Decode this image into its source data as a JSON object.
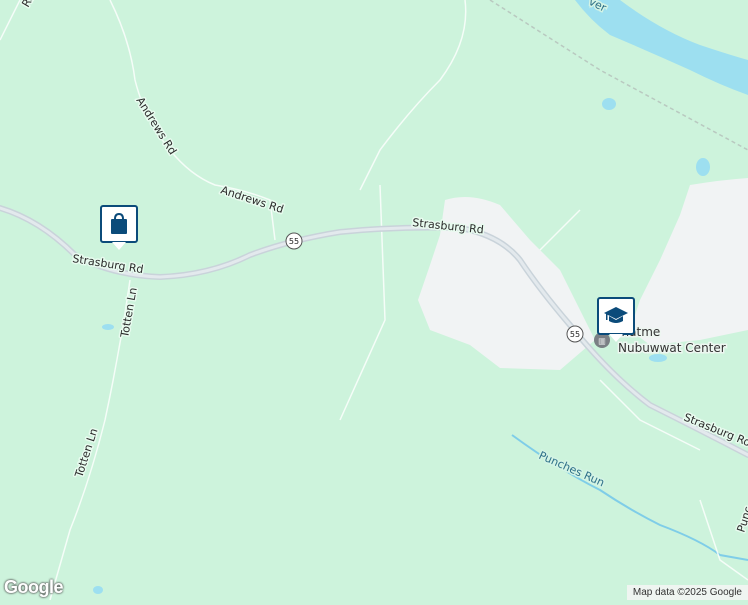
{
  "map": {
    "roads": {
      "strasburg_rd_west": "Strasburg Rd",
      "strasburg_rd_center": "Strasburg Rd",
      "strasburg_rd_east": "Strasburg Ro",
      "andrews_rd_north": "Andrews Rd",
      "andrews_rd_south": "Andrews Rd",
      "totten_ln_north": "Totten Ln",
      "totten_ln_south": "Totten Ln",
      "route_shield_west": "55",
      "route_shield_east": "55",
      "top_left_fragment": "Ro",
      "east_edge_fragment": "Punc"
    },
    "water": {
      "stream": "Punches Run",
      "river_fragment": "ver"
    },
    "places": {
      "center_name_line1": "Ihatme",
      "center_name_line2": "Nubuwwat Center"
    },
    "markers": {
      "shopping": "shopping-bag-icon",
      "school": "graduation-cap-icon"
    },
    "colors": {
      "land": "#cdf3dc",
      "urban": "#f1f3f4",
      "water": "#9ddff0",
      "highway": "#c9d3da",
      "marker_fill": "#0b4b7a"
    }
  },
  "footer": {
    "attribution": "Map data ©2025 Google",
    "logo": "Google"
  }
}
